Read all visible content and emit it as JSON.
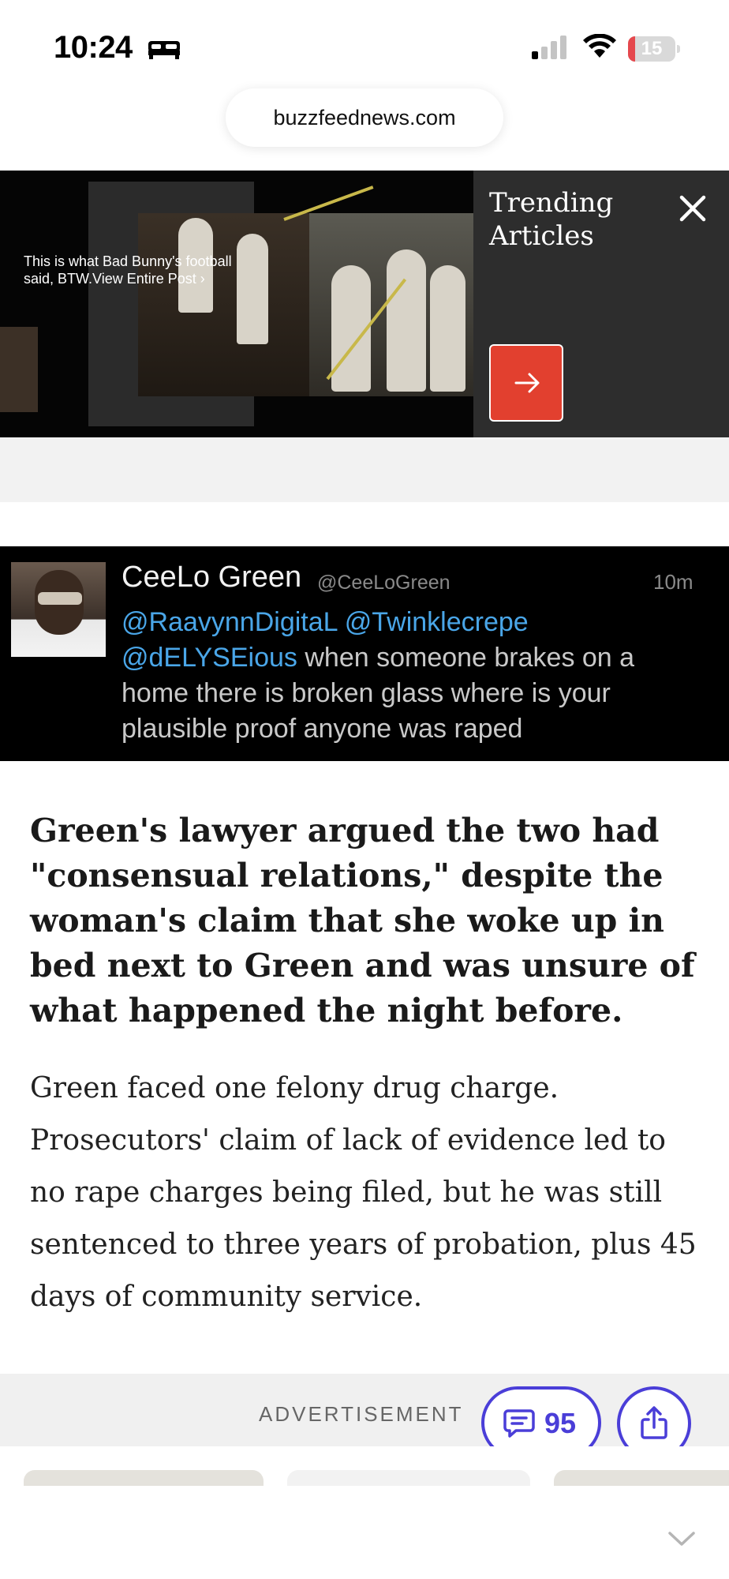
{
  "status_bar": {
    "time": "10:24",
    "battery_level": "15",
    "battery_percent": 15,
    "icons": [
      "bed-icon",
      "signal-icon",
      "wifi-icon",
      "battery-icon"
    ]
  },
  "browser": {
    "url": "buzzfeednews.com"
  },
  "trending_banner": {
    "caption": "This is what Bad Bunny's football said, BTW.View Entire Post ›",
    "title": "Trending Articles",
    "close_icon": "close-icon",
    "next_icon": "arrow-right-icon",
    "accent_color": "#e2402f"
  },
  "tweet_embed": {
    "name": "CeeLo Green",
    "handle": "@CeeLoGreen",
    "time": "10m",
    "mentions": [
      "@RaavynnDigitaL",
      "@Twinklecrepe",
      "@dELYSEious"
    ],
    "text": "when someone brakes on a home there is broken glass where is your plausible proof anyone was raped"
  },
  "article": {
    "headline": "Green's lawyer argued the two had \"consensual relations,\" despite the woman's claim that she woke up in bed next to Green and was unsure of what happened the night before.",
    "body": "Green faced one felony drug charge. Prosecutors' claim of lack of evidence led to no rape charges being filed, but he was still sentenced to three years of probation, plus 45 days of community service."
  },
  "ad": {
    "label": "ADVERTISEMENT"
  },
  "actions": {
    "comment_count": "95",
    "accent_color": "#4a3ed8"
  }
}
